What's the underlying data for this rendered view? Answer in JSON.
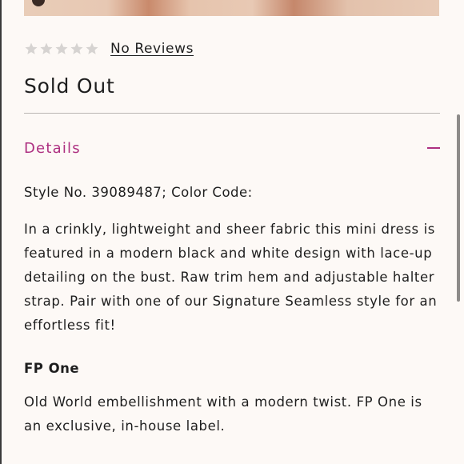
{
  "rating": {
    "stars_filled": 0,
    "stars_total": 5,
    "star_color": "#d6d3d1",
    "reviews_link": "No Reviews"
  },
  "product": {
    "status": "Sold Out"
  },
  "details": {
    "title": "Details",
    "accent_color": "#ad2f80",
    "toggle_icon": "minus-icon",
    "style_line": "Style No. 39089487; Color Code:",
    "description": "In a crinkly, lightweight and sheer fabric this mini dress is featured in a modern black and white design with lace-up detailing on the bust. Raw trim hem and adjustable halter strap. Pair with one of our Signature Seamless style for an effortless fit!",
    "brand_title": "FP One",
    "brand_description": "Old World embellishment with a modern twist. FP One is an exclusive, in-house label."
  }
}
